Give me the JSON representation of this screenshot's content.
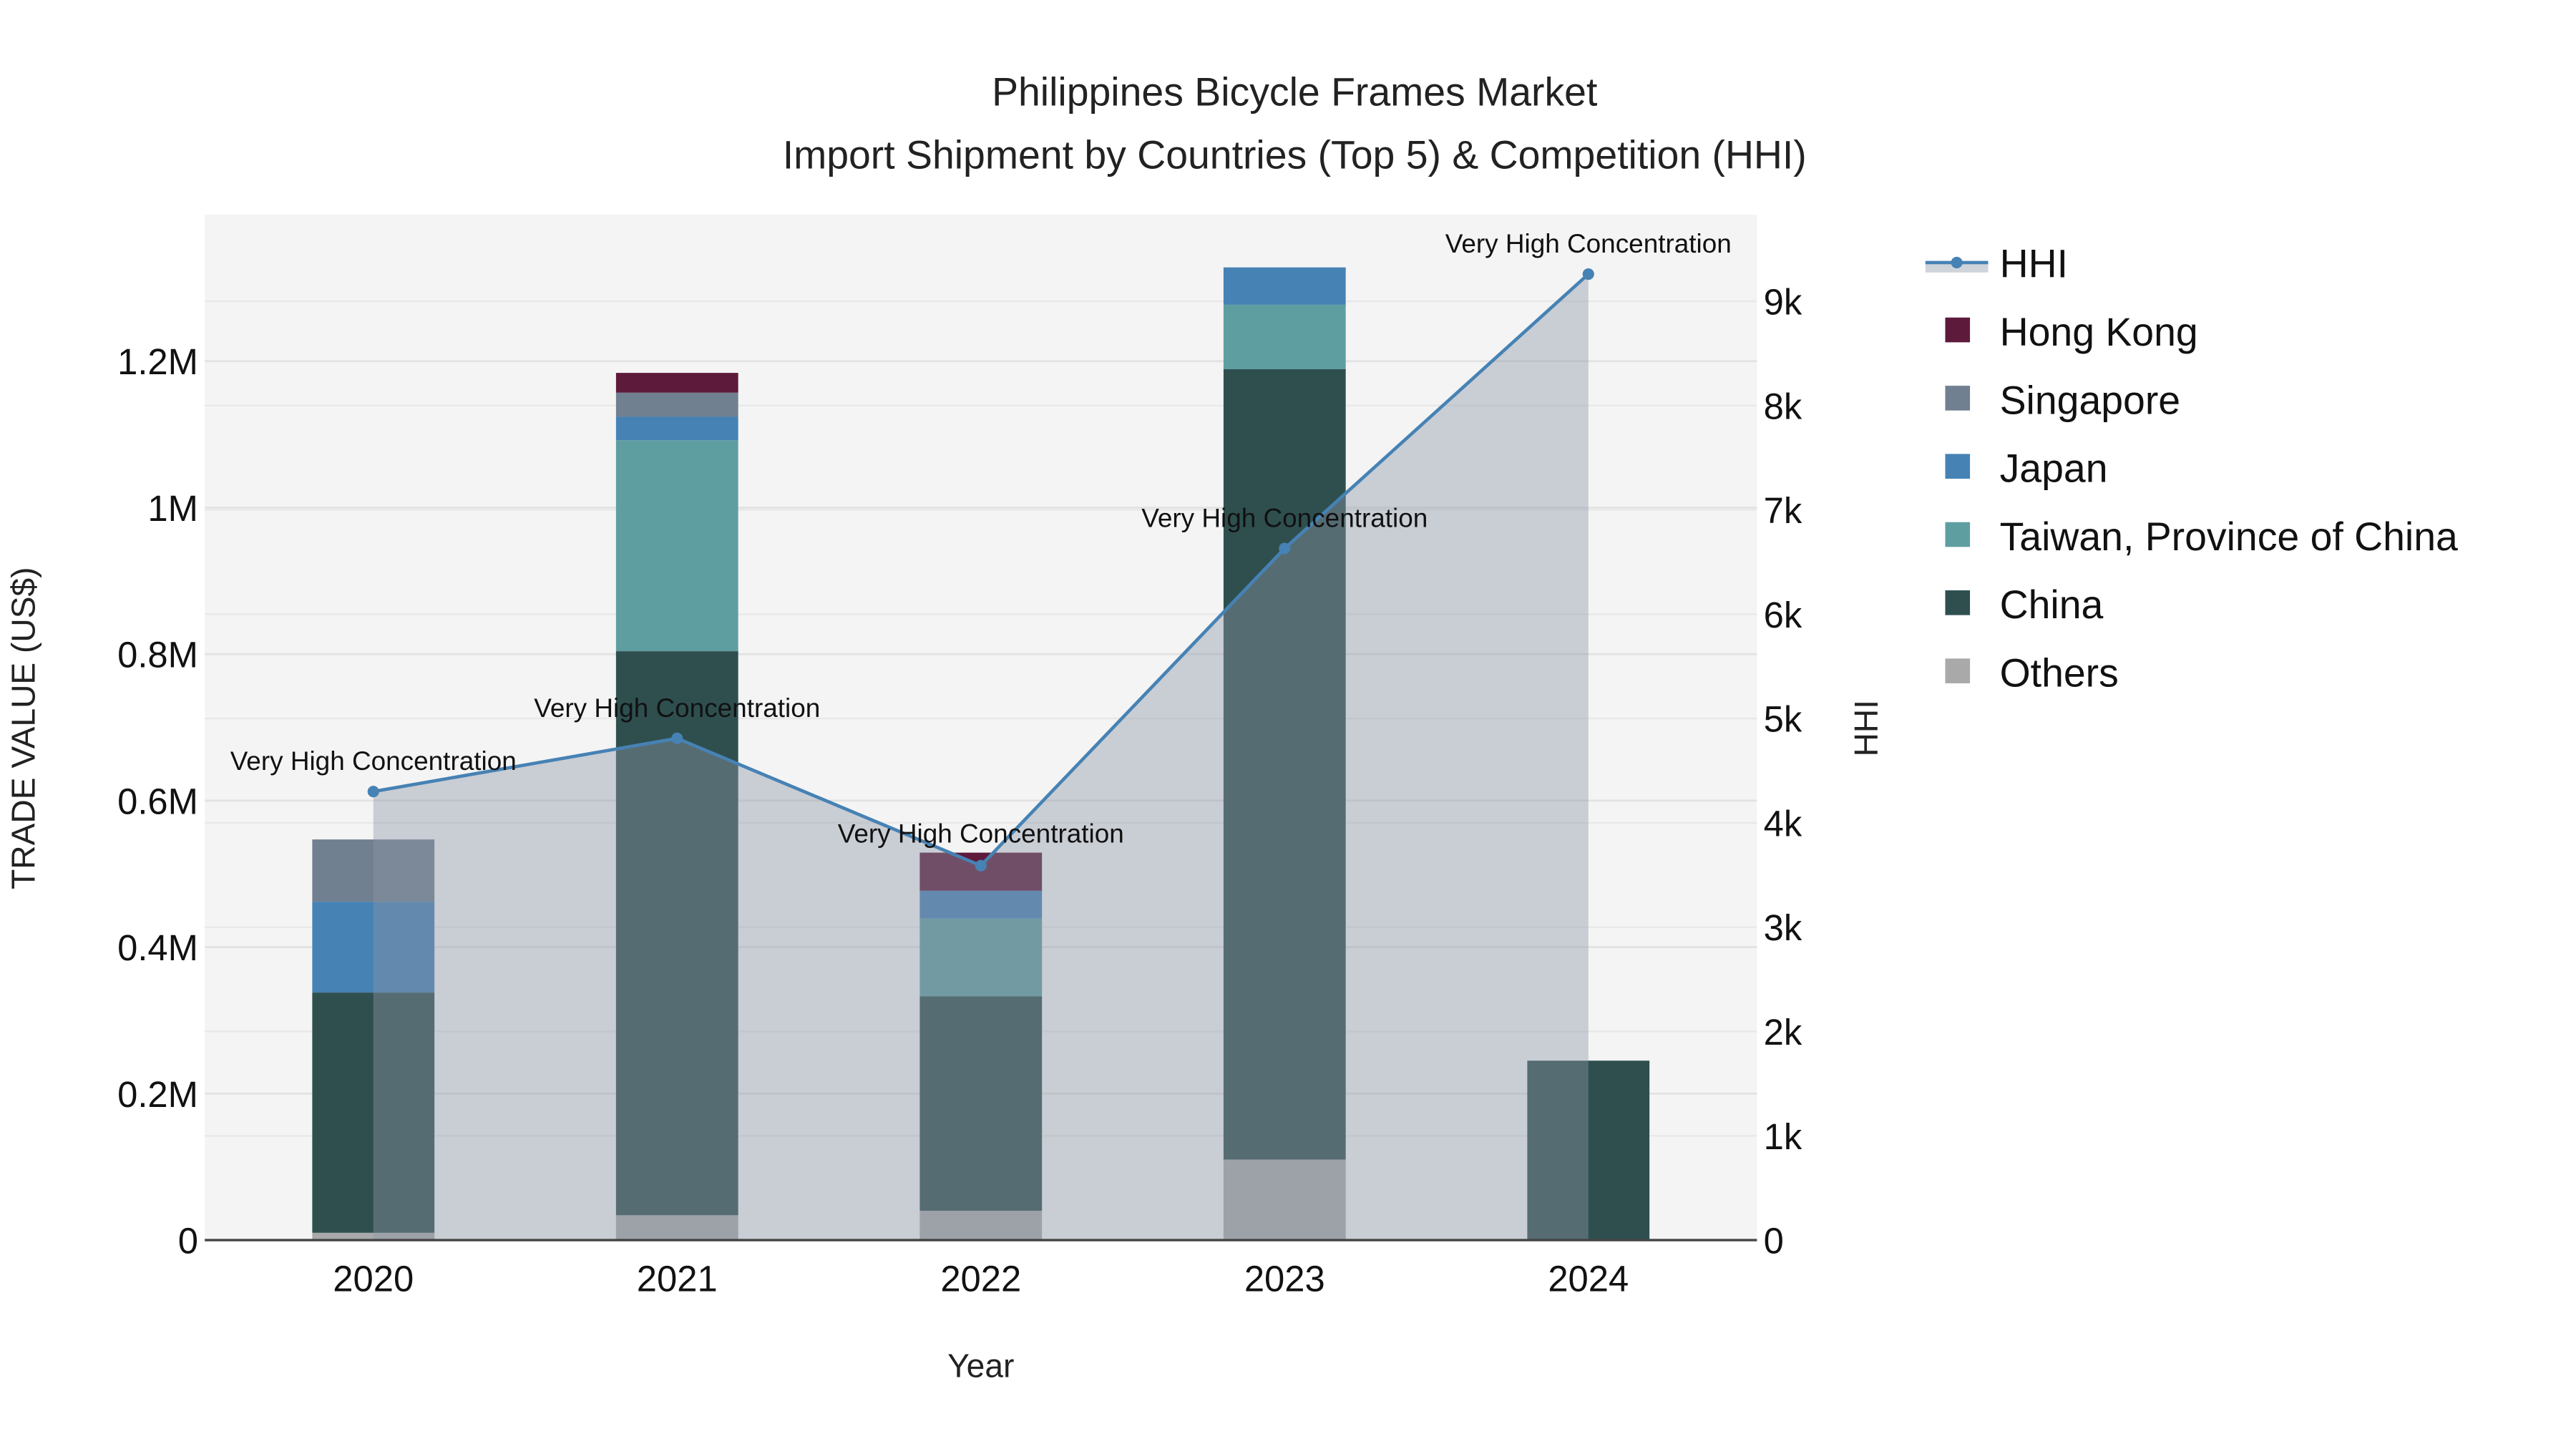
{
  "chart_data": {
    "type": "bar",
    "title": "Philippines Bicycle Frames Market",
    "subtitle": "Import Shipment by Countries (Top 5) & Competition (HHI)",
    "xlabel": "Year",
    "ylabel": "TRADE VALUE (US$)",
    "y2label": "HHI",
    "categories": [
      "2020",
      "2021",
      "2022",
      "2023",
      "2024"
    ],
    "ylim": [
      0,
      1400000
    ],
    "y2lim": [
      0,
      9830
    ],
    "yticks": [
      {
        "value": 0,
        "label": "0"
      },
      {
        "value": 200000,
        "label": "0.2M"
      },
      {
        "value": 400000,
        "label": "0.4M"
      },
      {
        "value": 600000,
        "label": "0.6M"
      },
      {
        "value": 800000,
        "label": "0.8M"
      },
      {
        "value": 1000000,
        "label": "1M"
      },
      {
        "value": 1200000,
        "label": "1.2M"
      }
    ],
    "y2ticks": [
      {
        "value": 0,
        "label": "0"
      },
      {
        "value": 1000,
        "label": "1k"
      },
      {
        "value": 2000,
        "label": "2k"
      },
      {
        "value": 3000,
        "label": "3k"
      },
      {
        "value": 4000,
        "label": "4k"
      },
      {
        "value": 5000,
        "label": "5k"
      },
      {
        "value": 6000,
        "label": "6k"
      },
      {
        "value": 7000,
        "label": "7k"
      },
      {
        "value": 8000,
        "label": "8k"
      },
      {
        "value": 9000,
        "label": "9k"
      }
    ],
    "stack_order": [
      "Others",
      "China",
      "Taiwan, Province of China",
      "Japan",
      "Singapore",
      "Hong Kong"
    ],
    "series": [
      {
        "name": "Others",
        "color": "#a9a9a9",
        "values": [
          10000,
          34000,
          40000,
          110000,
          0
        ]
      },
      {
        "name": "China",
        "color": "#2f4f4f",
        "values": [
          328000,
          770000,
          293000,
          1079000,
          245000
        ]
      },
      {
        "name": "Taiwan, Province of China",
        "color": "#5f9ea0",
        "values": [
          0,
          288000,
          106000,
          88000,
          0
        ]
      },
      {
        "name": "Japan",
        "color": "#4682b4",
        "values": [
          124000,
          32000,
          38000,
          51000,
          0
        ]
      },
      {
        "name": "Singapore",
        "color": "#708090",
        "values": [
          85000,
          33000,
          0,
          0,
          0
        ]
      },
      {
        "name": "Hong Kong",
        "color": "#5e1a3b",
        "values": [
          0,
          27000,
          52000,
          0,
          0
        ]
      }
    ],
    "hhi": {
      "name": "HHI",
      "color": "#4682b4",
      "values": [
        4300,
        4810,
        3590,
        6630,
        9260
      ],
      "annotations": [
        "Very High Concentration",
        "Very High Concentration",
        "Very High Concentration",
        "Very High Concentration",
        "Very High Concentration"
      ]
    },
    "legend": {
      "placement": "right",
      "entries": [
        "HHI",
        "Hong Kong",
        "Singapore",
        "Japan",
        "Taiwan, Province of China",
        "China",
        "Others"
      ]
    }
  }
}
